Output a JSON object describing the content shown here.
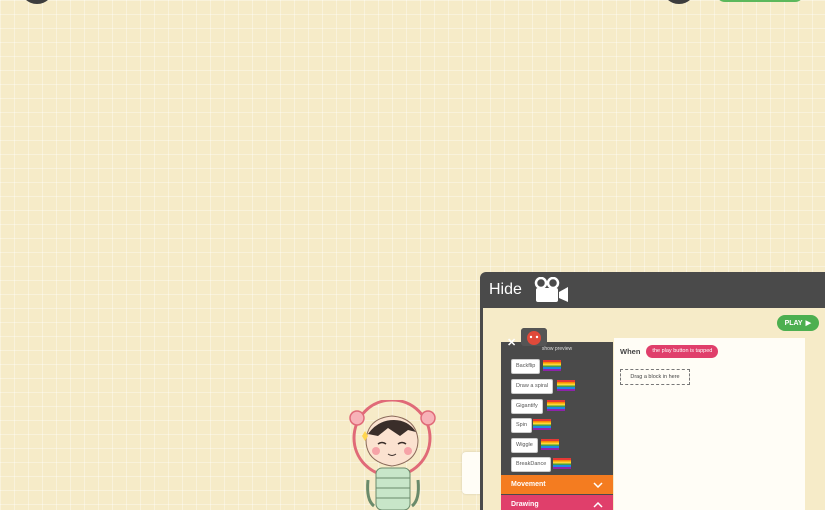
{
  "background": {
    "color": "#f6ebc8"
  },
  "top_bar": {
    "green_button_color": "#5cb85c"
  },
  "tutorial": {
    "hide_label": "Hide",
    "camera_icon": "video-camera-icon",
    "play_label": "PLAY",
    "play_icon": "play-triangle-icon",
    "sidebar": {
      "show_preview": "show preview",
      "blocks": [
        "Backflip",
        "Draw a spiral",
        "Gigantify",
        "Spin",
        "Wiggle",
        "BreakDance"
      ],
      "categories": [
        {
          "label": "Movement",
          "color": "#f47c20",
          "icon": "chevron-down-icon"
        },
        {
          "label": "Drawing",
          "color": "#e03f6b",
          "icon": "chevron-up-icon"
        }
      ]
    },
    "script": {
      "when_label": "When",
      "trigger": "the play button is tapped",
      "drop_hint": "Drag a block in here"
    }
  }
}
